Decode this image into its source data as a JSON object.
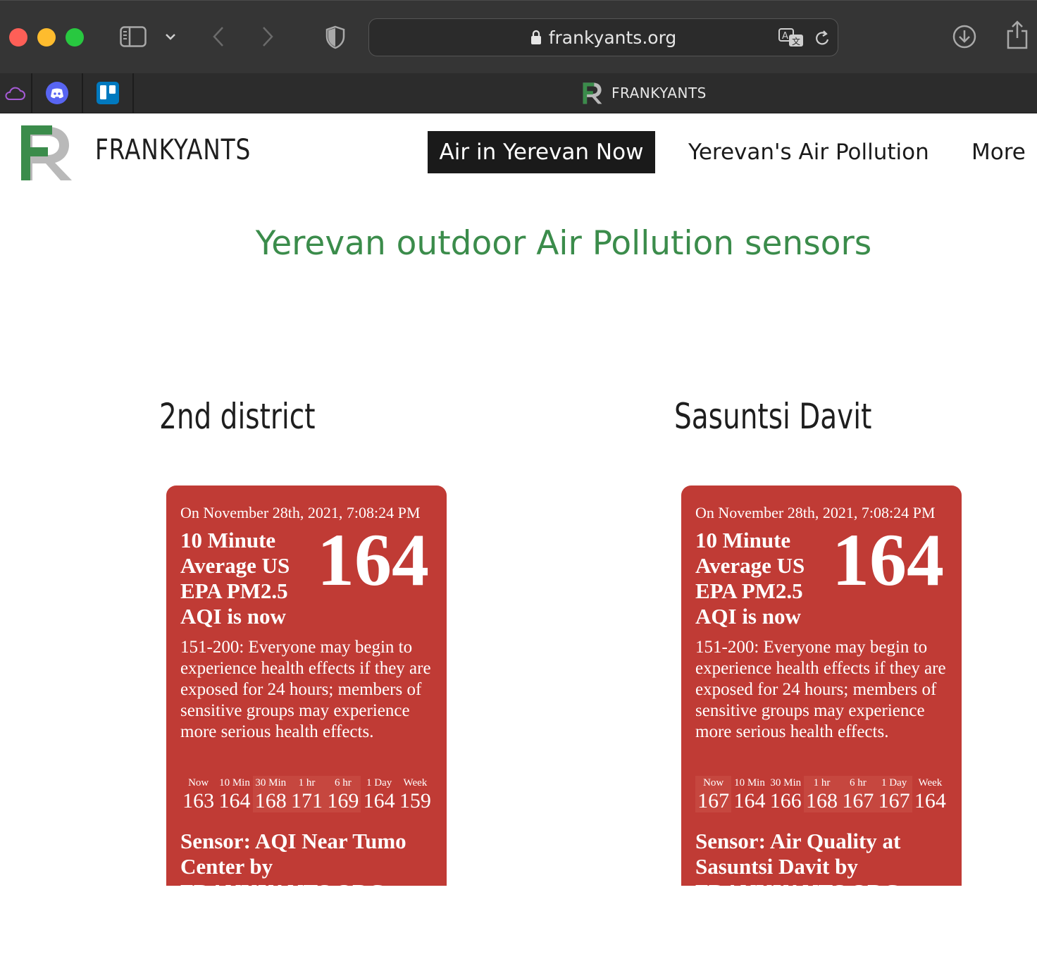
{
  "browser": {
    "url": "frankyants.org",
    "tab_title": "FRANKYANTS"
  },
  "site": {
    "name": "FRANKYANTS",
    "nav": {
      "active": "Air in Yerevan Now",
      "item2": "Yerevan's Air Pollution",
      "item3": "More"
    },
    "page_title": "Yerevan outdoor Air Pollution sensors"
  },
  "colors": {
    "accent_green": "#3b8c4b",
    "aqi_unhealthy": "#c03b35"
  },
  "sensors": [
    {
      "district": "2nd district",
      "date": "On November 28th, 2021, 7:08:24 PM",
      "label": "10 Minute Average US EPA PM2.5 AQI is now",
      "aqi": "164",
      "description": "151-200: Everyone may begin to experience health effects if they are exposed for 24 hours; members of sensitive groups may experience more serious health effects.",
      "history": [
        {
          "label": "Now",
          "value": "163"
        },
        {
          "label": "10 Min",
          "value": "164"
        },
        {
          "label": "30 Min",
          "value": "168"
        },
        {
          "label": "1 hr",
          "value": "171"
        },
        {
          "label": "6 hr",
          "value": "169"
        },
        {
          "label": "1 Day",
          "value": "164"
        },
        {
          "label": "Week",
          "value": "159"
        }
      ],
      "sensor_name": "Sensor: AQI Near Tumo Center by FRANKYANTS.ORG"
    },
    {
      "district": "Sasuntsi Davit",
      "date": "On November 28th, 2021, 7:08:24 PM",
      "label": "10 Minute Average US EPA PM2.5 AQI is now",
      "aqi": "164",
      "description": "151-200: Everyone may begin to experience health effects if they are exposed for 24 hours; members of sensitive groups may experience more serious health effects.",
      "history": [
        {
          "label": "Now",
          "value": "167"
        },
        {
          "label": "10 Min",
          "value": "164"
        },
        {
          "label": "30 Min",
          "value": "166"
        },
        {
          "label": "1 hr",
          "value": "168"
        },
        {
          "label": "6 hr",
          "value": "167"
        },
        {
          "label": "1 Day",
          "value": "167"
        },
        {
          "label": "Week",
          "value": "164"
        }
      ],
      "sensor_name": "Sensor: Air Quality at Sasuntsi Davit by FRANKYANTS.ORG"
    }
  ]
}
